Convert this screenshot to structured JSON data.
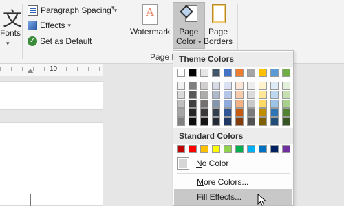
{
  "ribbon": {
    "font_glyph": "文",
    "fonts_label": "Fonts",
    "paragraph_spacing_label": "Paragraph Spacing",
    "effects_label": "Effects",
    "set_default_label": "Set as Default",
    "watermark_label": "Watermark",
    "page_color_line1": "Page",
    "page_color_line2": "Color",
    "page_borders_line1": "Page",
    "page_borders_line2": "Borders",
    "group_label": "Page B"
  },
  "ruler": {
    "number": "10"
  },
  "dropdown": {
    "theme_colors_label": "Theme Colors",
    "theme_base": [
      "#ffffff",
      "#000000",
      "#e7e6e6",
      "#44546a",
      "#4472c4",
      "#ed7d31",
      "#a5a5a5",
      "#ffc000",
      "#5b9bd5",
      "#70ad47"
    ],
    "theme_shades": [
      [
        "#f2f2f2",
        "#d9d9d9",
        "#bfbfbf",
        "#a6a6a6",
        "#808080"
      ],
      [
        "#7f7f7f",
        "#595959",
        "#404040",
        "#262626",
        "#0d0d0d"
      ],
      [
        "#d0cece",
        "#aeabab",
        "#757171",
        "#3a3838",
        "#171616"
      ],
      [
        "#d6dce4",
        "#adb9ca",
        "#8497b0",
        "#333f4f",
        "#222a35"
      ],
      [
        "#d9e1f2",
        "#b4c6e7",
        "#8ea9db",
        "#2f5597",
        "#1f3864"
      ],
      [
        "#fbe5d6",
        "#f8cbad",
        "#f4b183",
        "#c55a11",
        "#843c0c"
      ],
      [
        "#ededed",
        "#dbdbdb",
        "#c9c9c9",
        "#7b7b7b",
        "#525252"
      ],
      [
        "#fff2cc",
        "#ffe699",
        "#ffd966",
        "#bf8f00",
        "#7f6000"
      ],
      [
        "#ddebf7",
        "#bdd7ee",
        "#9dc3e6",
        "#2e75b6",
        "#1f4e79"
      ],
      [
        "#e2efda",
        "#c6e0b4",
        "#a9d18e",
        "#548235",
        "#375623"
      ]
    ],
    "standard_colors_label": "Standard Colors",
    "standard": [
      "#c00000",
      "#ff0000",
      "#ffc000",
      "#ffff00",
      "#92d050",
      "#00b050",
      "#00b0f0",
      "#0070c0",
      "#002060",
      "#7030a0"
    ],
    "no_color_label": "No Color",
    "more_colors_label": "More Colors...",
    "fill_effects_label": "Fill Effects..."
  }
}
